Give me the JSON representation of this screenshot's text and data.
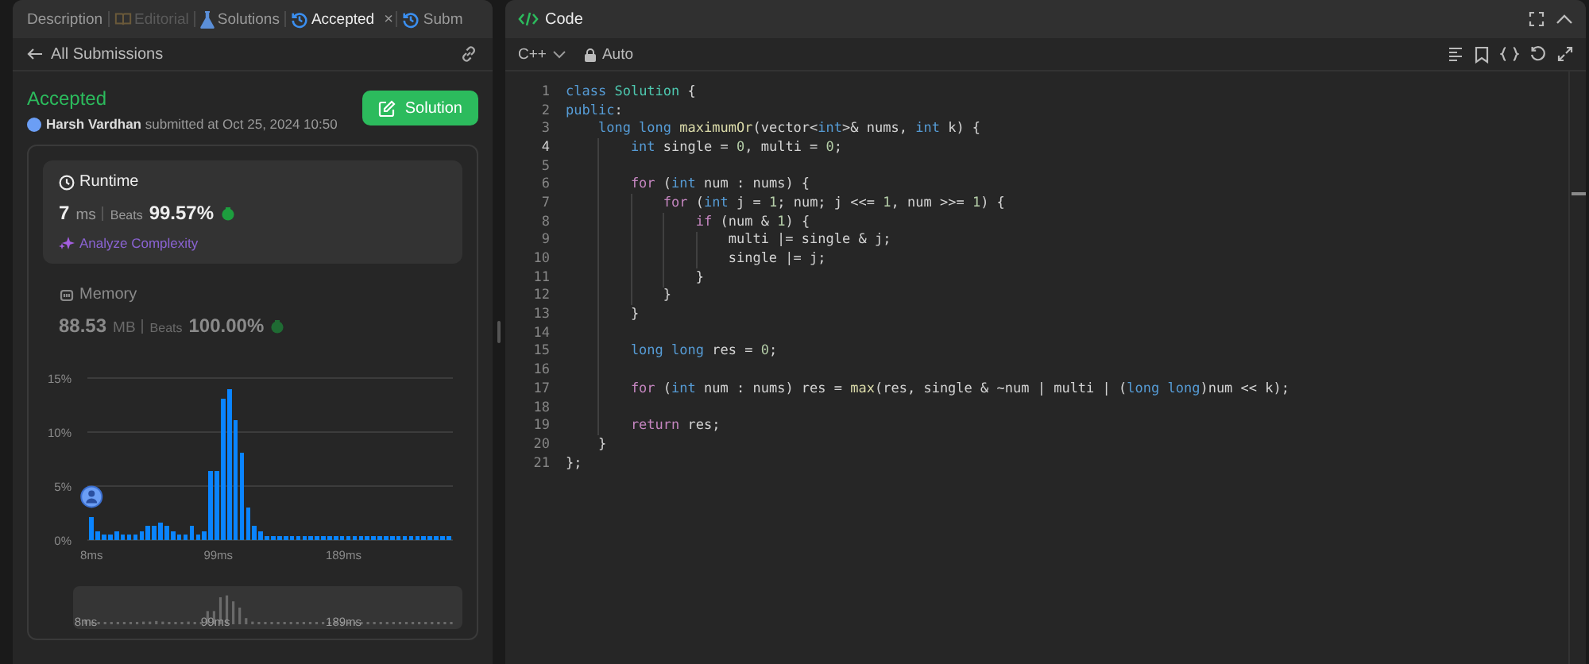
{
  "left_panel": {
    "tabs": [
      {
        "label": "Description",
        "selected": false,
        "disabled": false
      },
      {
        "label": "Editorial",
        "selected": false,
        "disabled": true
      },
      {
        "label": "Solutions",
        "selected": false,
        "disabled": false
      },
      {
        "label": "Accepted",
        "selected": true,
        "disabled": false,
        "close": "×"
      },
      {
        "label": "Subm",
        "selected": false,
        "disabled": false
      }
    ],
    "back_link": "All Submissions",
    "status": "Accepted",
    "author_line": "**Harsh Vardhan** submitted at Oct 25, 2024 10:50",
    "solution_button": "Solution",
    "stats": [
      {
        "label": "Runtime",
        "value": "7",
        "unit": "ms",
        "beats_label": "Beats",
        "beats": "99.57%",
        "selected": true,
        "link": "Analyze Complexity"
      },
      {
        "label": "Memory",
        "value": "88.53",
        "unit": "MB",
        "beats_label": "Beats",
        "beats": "100.00%",
        "selected": false
      }
    ],
    "chart_data": {
      "type": "bar",
      "x": [
        8,
        12.5,
        17,
        21.5,
        26,
        30.5,
        35,
        39.5,
        44,
        48.5,
        53,
        57.5,
        62,
        66.5,
        71,
        75.5,
        80,
        84.5,
        89,
        93.5,
        98,
        102.5,
        107,
        111.5,
        116,
        120.5,
        125,
        129.5,
        134,
        138.5,
        143,
        147.5,
        152,
        156.5,
        161,
        165.5,
        170,
        174.5,
        179,
        183.5,
        188,
        192.5,
        197,
        201.5,
        206,
        210.5,
        215,
        219.5,
        224,
        228.5,
        233,
        237.5,
        242,
        246.5,
        251,
        255.5,
        260,
        264.5
      ],
      "values": [
        2.1,
        0.8,
        0.5,
        0.5,
        0.8,
        0.5,
        0.5,
        0.5,
        0.8,
        1.3,
        1.3,
        1.6,
        1.3,
        0.8,
        0.5,
        0.5,
        1.3,
        0.5,
        0.8,
        6.4,
        6.4,
        13.1,
        14.0,
        11.1,
        8.1,
        3.0,
        1.3,
        0.8,
        0.4,
        0.4,
        0.4,
        0.4,
        0.4,
        0.4,
        0.4,
        0.4,
        0.4,
        0.4,
        0.4,
        0.4,
        0.4,
        0.4,
        0.4,
        0.4,
        0.4,
        0.4,
        0.4,
        0.4,
        0.4,
        0.4,
        0.4,
        0.4,
        0.4,
        0.4,
        0.4,
        0.4,
        0.4,
        0.4
      ],
      "xlim": [
        5,
        267.5
      ],
      "ylim": [
        0,
        15
      ],
      "yticks": [
        {
          "value": 0,
          "label": "0%"
        },
        {
          "value": 5,
          "label": "5%"
        },
        {
          "value": 10,
          "label": "10%"
        },
        {
          "value": 15,
          "label": "15%"
        }
      ],
      "xticks": [
        {
          "value": 8,
          "label": "8ms"
        },
        {
          "value": 99,
          "label": "99ms"
        },
        {
          "value": 189,
          "label": "189ms"
        }
      ]
    },
    "navigator_labels": [
      "8ms",
      "99ms",
      "189ms"
    ]
  },
  "code_panel": {
    "title": "Code",
    "language": "C++",
    "mode": "Auto",
    "lines": [
      {
        "number": "1",
        "active": false,
        "tokens": [
          {
            "kind": "keyword",
            "text": "class"
          },
          {
            "kind": "type",
            "text": " Solution"
          },
          {
            "kind": "plain",
            "text": " {"
          }
        ]
      },
      {
        "number": "2",
        "active": false,
        "tokens": [
          {
            "kind": "keyword",
            "text": "public"
          },
          {
            "kind": "plain",
            "text": ":"
          }
        ]
      },
      {
        "number": "3",
        "active": false,
        "tokens": [
          {
            "kind": "keyword",
            "text": "    long long"
          },
          {
            "kind": "function",
            "text": " maximumOr"
          },
          {
            "kind": "plain",
            "text": "(vector<"
          },
          {
            "kind": "keyword",
            "text": "int"
          },
          {
            "kind": "plain",
            "text": ">& nums, "
          },
          {
            "kind": "keyword",
            "text": "int"
          },
          {
            "kind": "plain",
            "text": " k) {"
          }
        ]
      },
      {
        "number": "4",
        "active": true,
        "tokens": [
          {
            "kind": "keyword",
            "text": "        int"
          },
          {
            "kind": "plain",
            "text": " single = "
          },
          {
            "kind": "number",
            "text": "0"
          },
          {
            "kind": "plain",
            "text": ", multi = "
          },
          {
            "kind": "number",
            "text": "0"
          },
          {
            "kind": "plain",
            "text": ";"
          }
        ]
      },
      {
        "number": "5",
        "active": false
      },
      {
        "number": "6",
        "active": false,
        "tokens": [
          {
            "kind": "control",
            "text": "        for"
          },
          {
            "kind": "plain",
            "text": " ("
          },
          {
            "kind": "keyword",
            "text": "int"
          },
          {
            "kind": "plain",
            "text": " num : nums) {"
          }
        ]
      },
      {
        "number": "7",
        "active": false,
        "tokens": [
          {
            "kind": "control",
            "text": "            for"
          },
          {
            "kind": "plain",
            "text": " ("
          },
          {
            "kind": "keyword",
            "text": "int"
          },
          {
            "kind": "plain",
            "text": " j = "
          },
          {
            "kind": "number",
            "text": "1"
          },
          {
            "kind": "plain",
            "text": "; num; j <<= "
          },
          {
            "kind": "number",
            "text": "1"
          },
          {
            "kind": "plain",
            "text": ", num >>= "
          },
          {
            "kind": "number",
            "text": "1"
          },
          {
            "kind": "plain",
            "text": ") {"
          }
        ]
      },
      {
        "number": "8",
        "active": false,
        "tokens": [
          {
            "kind": "control",
            "text": "                if"
          },
          {
            "kind": "plain",
            "text": " (num & "
          },
          {
            "kind": "number",
            "text": "1"
          },
          {
            "kind": "plain",
            "text": ") {"
          }
        ]
      },
      {
        "number": "9",
        "active": false,
        "tokens": [
          {
            "kind": "plain",
            "text": "                    multi |= single & j;"
          }
        ]
      },
      {
        "number": "10",
        "active": false,
        "tokens": [
          {
            "kind": "plain",
            "text": "                    single |= j;"
          }
        ]
      },
      {
        "number": "11",
        "active": false,
        "tokens": [
          {
            "kind": "plain",
            "text": "                }"
          }
        ]
      },
      {
        "number": "12",
        "active": false,
        "tokens": [
          {
            "kind": "plain",
            "text": "            }"
          }
        ]
      },
      {
        "number": "13",
        "active": false,
        "tokens": [
          {
            "kind": "plain",
            "text": "        }"
          }
        ]
      },
      {
        "number": "14",
        "active": false
      },
      {
        "number": "15",
        "active": false,
        "tokens": [
          {
            "kind": "keyword",
            "text": "        long long"
          },
          {
            "kind": "plain",
            "text": " res = "
          },
          {
            "kind": "number",
            "text": "0"
          },
          {
            "kind": "plain",
            "text": ";"
          }
        ]
      },
      {
        "number": "16",
        "active": false
      },
      {
        "number": "17",
        "active": false,
        "tokens": [
          {
            "kind": "control",
            "text": "        for"
          },
          {
            "kind": "plain",
            "text": " ("
          },
          {
            "kind": "keyword",
            "text": "int"
          },
          {
            "kind": "plain",
            "text": " num : nums) res = "
          },
          {
            "kind": "function",
            "text": "max"
          },
          {
            "kind": "plain",
            "text": "(res, single & ~num | multi | ("
          },
          {
            "kind": "keyword",
            "text": "long long"
          },
          {
            "kind": "plain",
            "text": ")num << k);"
          }
        ]
      },
      {
        "number": "18",
        "active": false
      },
      {
        "number": "19",
        "active": false,
        "tokens": [
          {
            "kind": "control",
            "text": "        return"
          },
          {
            "kind": "plain",
            "text": " res;"
          }
        ]
      },
      {
        "number": "20",
        "active": false,
        "tokens": [
          {
            "kind": "plain",
            "text": "    }"
          }
        ]
      },
      {
        "number": "21",
        "active": false,
        "tokens": [
          {
            "kind": "plain",
            "text": "};"
          }
        ]
      }
    ]
  }
}
